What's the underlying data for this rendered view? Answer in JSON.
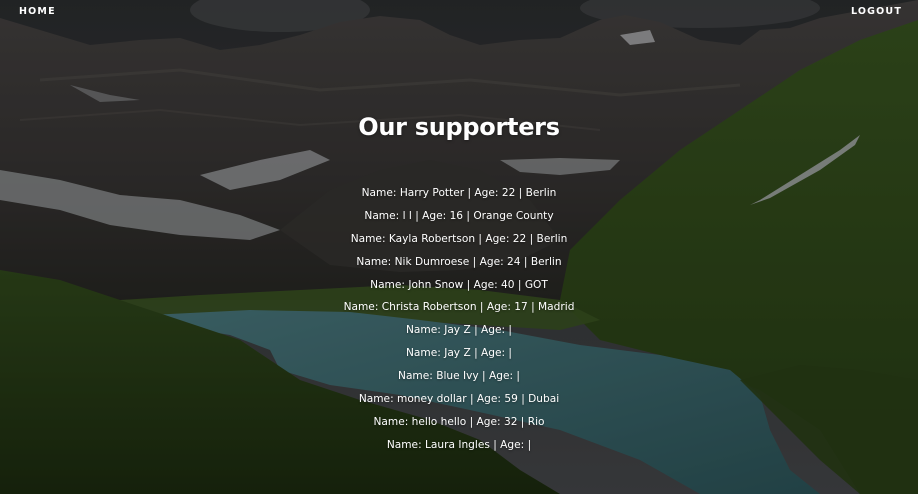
{
  "nav": {
    "home_label": "HOME",
    "logout_label": "LOGOUT"
  },
  "page": {
    "title": "Our supporters"
  },
  "supporters": [
    "Name: Harry Potter | Age: 22 | Berlin",
    "Name: l l | Age: 16 | Orange County",
    "Name: Kayla Robertson | Age: 22 | Berlin",
    "Name: Nik Dumroese | Age: 24 | Berlin",
    "Name: John Snow | Age: 40 | GOT",
    "Name: Christa Robertson | Age: 17 | Madrid",
    "Name: Jay Z | Age: |",
    "Name: Jay Z | Age: |",
    "Name: Blue Ivy | Age: |",
    "Name: money dollar | Age: 59 | Dubai",
    "Name: hello hello | Age: 32 | Rio",
    "Name: Laura Ingles | Age: |"
  ],
  "colors": {
    "text": "#ffffff",
    "sky": "#3a3c3f",
    "mountain": "#3b3a3a",
    "snow": "#a9acaf",
    "grass": "#36521f",
    "lake": "#3e6a6f"
  }
}
